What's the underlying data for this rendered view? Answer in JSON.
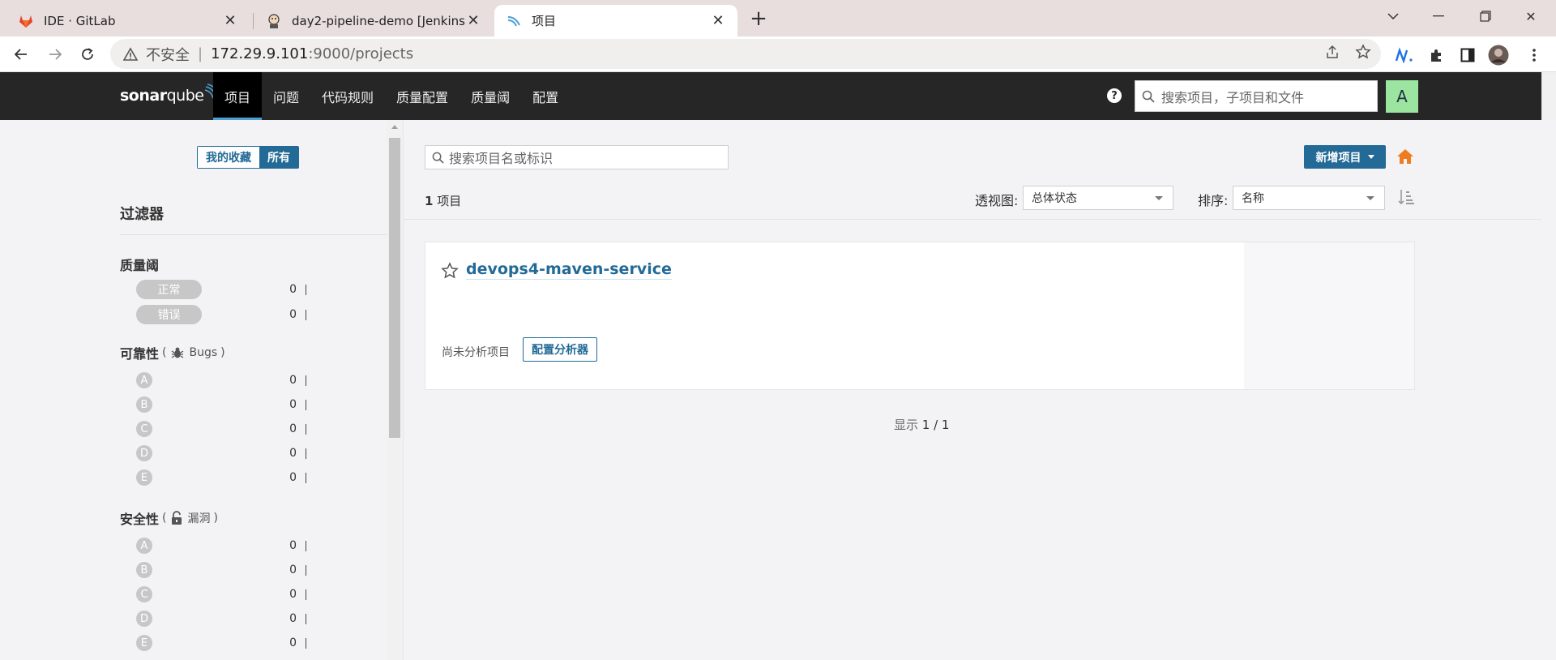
{
  "browser": {
    "tabs": [
      {
        "title": "IDE · GitLab",
        "icon": "gitlab-icon"
      },
      {
        "title": "day2-pipeline-demo [Jenkins]",
        "icon": "jenkins-icon"
      },
      {
        "title": "项目",
        "icon": "sonarqube-icon"
      }
    ],
    "address": {
      "insecure_label": "不安全",
      "host": "172.29.9.101",
      "path": ":9000/projects"
    }
  },
  "sonar": {
    "logo_bold": "sonar",
    "logo_light": "qube",
    "menu": [
      "项目",
      "问题",
      "代码规则",
      "质量配置",
      "质量阈",
      "配置"
    ],
    "search_placeholder": "搜索项目，子项目和文件",
    "avatar_letter": "A",
    "accent": "#236a97",
    "avatar_color": "#9ce5a0"
  },
  "sidebar": {
    "toggle": {
      "favorites": "我的收藏",
      "all": "所有"
    },
    "filters_title": "过滤器",
    "quality_gate": {
      "title": "质量阈",
      "items": [
        {
          "label": "正常",
          "count": "0"
        },
        {
          "label": "错误",
          "count": "0"
        }
      ]
    },
    "reliability": {
      "title": "可靠性",
      "paren_open": "(",
      "sub": "Bugs",
      "paren_close": ")",
      "grades": [
        {
          "label": "A",
          "count": "0"
        },
        {
          "label": "B",
          "count": "0"
        },
        {
          "label": "C",
          "count": "0"
        },
        {
          "label": "D",
          "count": "0"
        },
        {
          "label": "E",
          "count": "0"
        }
      ]
    },
    "security": {
      "title": "安全性",
      "paren_open": "(",
      "sub": "漏洞",
      "paren_close": ")",
      "grades": [
        {
          "label": "A",
          "count": "0"
        },
        {
          "label": "B",
          "count": "0"
        },
        {
          "label": "C",
          "count": "0"
        },
        {
          "label": "D",
          "count": "0"
        },
        {
          "label": "E",
          "count": "0"
        }
      ]
    }
  },
  "main": {
    "search_placeholder": "搜索项目名或标识",
    "new_project": "新增项目",
    "count_num": "1",
    "count_text": "项目",
    "perspective_label": "透视图:",
    "perspective_value": "总体状态",
    "sort_label": "排序:",
    "sort_value": "名称",
    "project": {
      "name": "devops4-maven-service",
      "status": "尚未分析项目",
      "config_button": "配置分析器"
    },
    "showing_label": "显示",
    "showing_value": "1 / 1"
  }
}
